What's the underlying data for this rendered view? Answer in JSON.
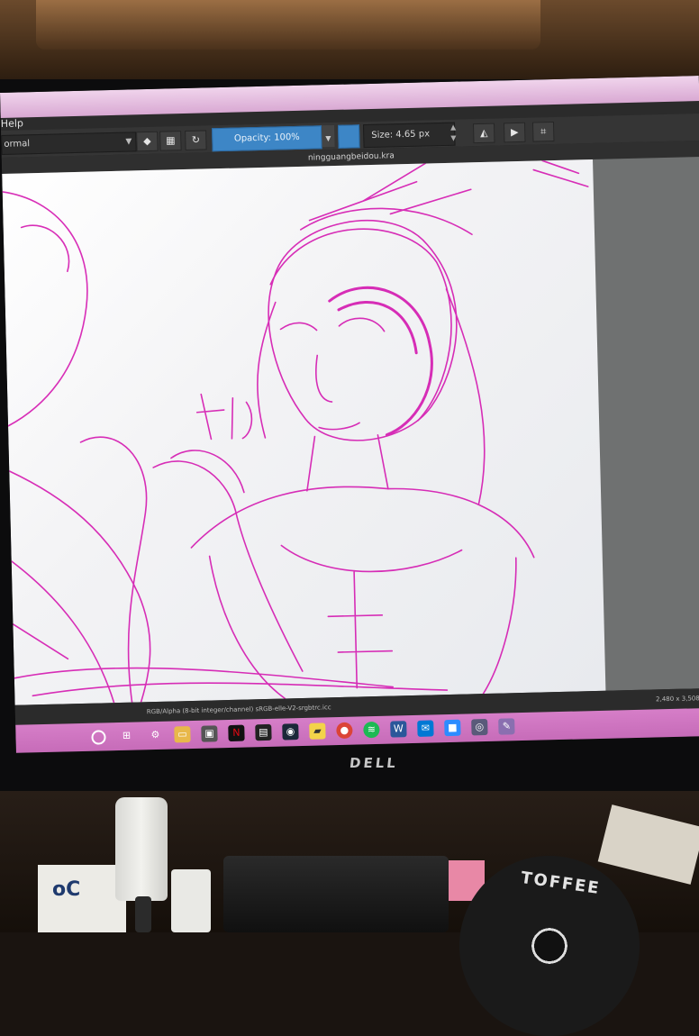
{
  "app": {
    "menu_help": "Help",
    "document_title": "ningguangbeidou.kra"
  },
  "toolbar": {
    "blend_mode": "ormal",
    "opacity_label": "Opacity: 100%",
    "size_label": "Size: 4.65 px"
  },
  "status_bar": {
    "color_space": "RGB/Alpha (8-bit integer/channel)  sRGB-elle-V2-srgbtrc.icc",
    "image_size": "2,480 x 3,508 (22"
  },
  "taskbar": {
    "pinned_icons": [
      "search-icon",
      "task-view-icon",
      "settings-icon",
      "file-explorer-icon",
      "store-icon",
      "netflix-icon",
      "photoshop-icon",
      "steam-icon",
      "sticky-notes-icon",
      "chrome-icon",
      "spotify-icon",
      "word-icon",
      "mail-icon",
      "zoom-icon",
      "camera-icon",
      "krita-icon"
    ]
  },
  "monitor": {
    "brand": "DELL"
  },
  "desk": {
    "box_label": "oC",
    "disc_label": "TOFFEE"
  },
  "colors": {
    "sketch_stroke": "#d418b0",
    "accent_blue": "#3d86c6",
    "taskbar_pink": "#d67ec8"
  }
}
